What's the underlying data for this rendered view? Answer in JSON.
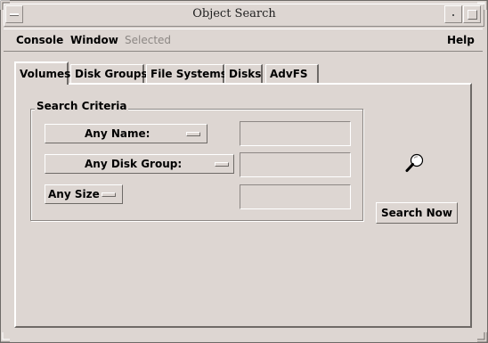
{
  "window": {
    "title": "Object Search"
  },
  "menubar": {
    "items": [
      {
        "label": "Console",
        "enabled": true
      },
      {
        "label": "Window",
        "enabled": true
      },
      {
        "label": "Selected",
        "enabled": false
      }
    ],
    "help": "Help"
  },
  "tabs": [
    {
      "label": "Volumes",
      "active": true
    },
    {
      "label": "Disk Groups",
      "active": false
    },
    {
      "label": "File Systems",
      "active": false
    },
    {
      "label": "Disks",
      "active": false
    },
    {
      "label": "AdvFS",
      "active": false
    }
  ],
  "criteria": {
    "group_label": "Search Criteria",
    "name_option": {
      "selected": "Any Name:",
      "value": ""
    },
    "disk_group_option": {
      "selected": "Any Disk Group:",
      "value": ""
    },
    "size_option": {
      "selected": "Any Size",
      "value": ""
    }
  },
  "actions": {
    "search_now": "Search Now",
    "search_icon": "magnifier-icon"
  }
}
